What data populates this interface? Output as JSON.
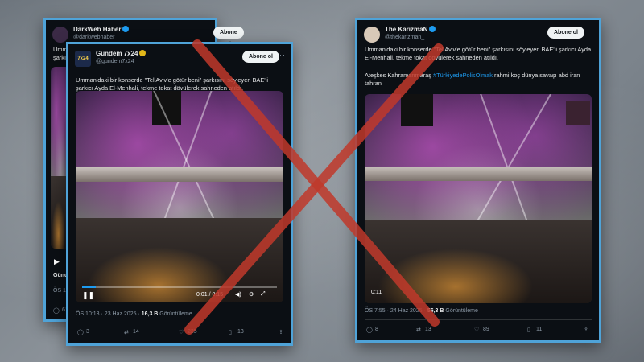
{
  "back_tweet": {
    "name": "DarkWeb Haber",
    "handle": "@darkwebhaber",
    "follow_label": "Abone ol",
    "text_fragment_1": "Umman",
    "text_fragment_2": "şarkıcı",
    "caption_fragment": "Günde",
    "time_fragment": "ÖS 10:2",
    "replies": "61"
  },
  "front_tweet": {
    "name": "Gündem 7x24",
    "handle": "@gundem7x24",
    "avatar_text": "7x24",
    "follow_label": "Abone ol",
    "text": "Umman'daki bir konserde \"Tel Aviv'e götür beni\" şarkısını söyleyen BAE'li şarkıcı Ayda El-Menhali, tekme tokat dövülerek sahneden atıldı.",
    "video_time": "0:01 / 0:15",
    "progress": 0.07,
    "timestamp": "ÖS 10:13 · 23 Haz 2025 · ",
    "views": "16,3 B",
    "views_label": "Görüntüleme",
    "replies": "3",
    "retweets": "14",
    "likes": "235",
    "bookmarks": "13"
  },
  "right_tweet": {
    "name": "The KarizmaN",
    "handle": "@thekarizman_",
    "follow_label": "Abone ol",
    "text": "Umman'daki bir konserde \"Tel Aviv'e götür beni\" şarkısını söyleyen BAE'li şarkıcı Ayda El-Menhali, tekme tokat dövülerek sahneden atıldı.",
    "text2_prefix": "Ateşkes Kahramanmaraş ",
    "hashtag": "#TürkiyedePolisOlmak",
    "text2_suffix": " rahmi koç dünya savaşı abd iran tahran",
    "video_time": "0:11",
    "timestamp": "ÖS 7:55 · 24 Haz 2025 · ",
    "views": "56,3 B",
    "views_label": "Görüntüleme",
    "replies": "8",
    "retweets": "13",
    "likes": "89",
    "bookmarks": "11"
  },
  "colors": {
    "frame_border": "#4fa3d8",
    "x_mark": "#c0392b",
    "link": "#1d9bf0"
  }
}
